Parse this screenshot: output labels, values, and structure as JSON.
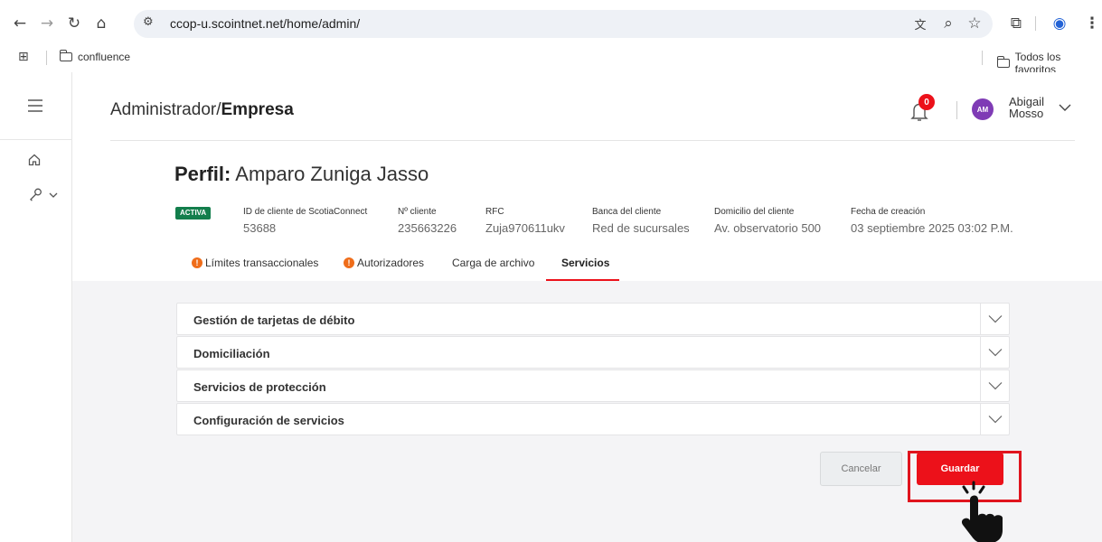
{
  "browser": {
    "url": "ccop-u.scointnet.net/home/admin/",
    "bookmarks": [
      {
        "label": "confluence"
      }
    ],
    "favorites_label": "Todos los favoritos"
  },
  "header": {
    "breadcrumb_prefix": "Administrador/",
    "breadcrumb_current": "Empresa",
    "notifications_count": "0",
    "avatar_initials": "AM",
    "user_first": "Abigail",
    "user_last": "Mosso"
  },
  "profile": {
    "title_label": "Perfil:",
    "title_name": "Amparo Zuniga Jasso",
    "status": "ACTIVA",
    "fields": [
      {
        "label": "ID de cliente de ScotiaConnect",
        "value": "53688"
      },
      {
        "label": "Nº cliente",
        "value": "235663226"
      },
      {
        "label": "RFC",
        "value": "Zuja970611ukv"
      },
      {
        "label": "Banca del cliente",
        "value": "Red de sucursales"
      },
      {
        "label": "Domicilio del cliente",
        "value": "Av. observatorio 500"
      },
      {
        "label": "Fecha de creación",
        "value": "03 septiembre 2025 03:02 P.M."
      }
    ]
  },
  "tabs": [
    {
      "label": "Límites transaccionales",
      "warning": true
    },
    {
      "label": "Autorizadores",
      "warning": true
    },
    {
      "label": "Carga de archivo",
      "warning": false
    },
    {
      "label": "Servicios",
      "warning": false,
      "active": true
    }
  ],
  "accordion": [
    {
      "title": "Gestión de tarjetas de débito"
    },
    {
      "title": "Domiciliación"
    },
    {
      "title": "Servicios de protección"
    },
    {
      "title": "Configuración de servicios"
    }
  ],
  "actions": {
    "cancel_label": "Cancelar",
    "save_label": "Guardar"
  },
  "colors": {
    "brand_red": "#ec111a",
    "active_badge": "#137e4c",
    "warning": "#ef6d1a",
    "avatar": "#7f3bb5"
  },
  "icons": {
    "warning": "!",
    "chevron": "chevron-down-icon"
  }
}
